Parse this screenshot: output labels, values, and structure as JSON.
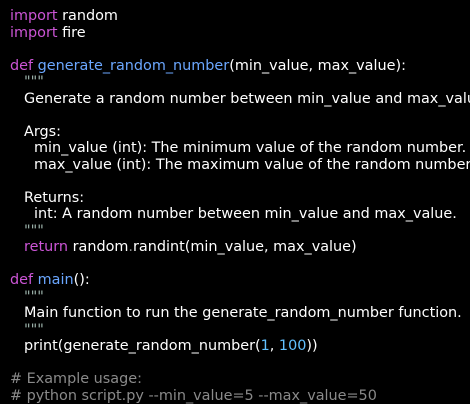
{
  "code": {
    "l1": {
      "kw": "import",
      "name": " random"
    },
    "l2": {
      "kw": "import",
      "name": " fire"
    },
    "l4": {
      "kw": "def",
      "name": "generate_random_number",
      "params": "(min_value, max_value):"
    },
    "l5": {
      "quote": "\"\"\""
    },
    "l6": {
      "text": "Generate a random number between min_value and max_value."
    },
    "l8": {
      "text": "Args:"
    },
    "l9": {
      "text": "min_value (int): The minimum value of the random number."
    },
    "l10": {
      "text": "max_value (int): The maximum value of the random number."
    },
    "l12": {
      "text": "Returns:"
    },
    "l13": {
      "text": "int: A random number between min_value and max_value."
    },
    "l14": {
      "quote": "\"\"\""
    },
    "l15": {
      "kw": "return",
      "obj": "random",
      "dot": ".",
      "call": "randint(min_value, max_value)"
    },
    "l17": {
      "kw": "def",
      "name": "main",
      "params": "():"
    },
    "l18": {
      "quote": "\"\"\""
    },
    "l19": {
      "text": "Main function to run the generate_random_number function."
    },
    "l20": {
      "quote": "\"\"\""
    },
    "l21": {
      "pre": "print(generate_random_number(",
      "n1": "1",
      "sep": ", ",
      "n2": "100",
      "post": "))"
    },
    "l23": {
      "text": "# Example usage:"
    },
    "l24": {
      "text": "# python script.py --min_value=5 --max_value=50"
    }
  },
  "colors": {
    "background": "#000000",
    "keyword": "#cc55d6",
    "function": "#6ba7ff",
    "number": "#62c1ff",
    "comment": "#8a8a8a",
    "text": "#ffffff"
  }
}
